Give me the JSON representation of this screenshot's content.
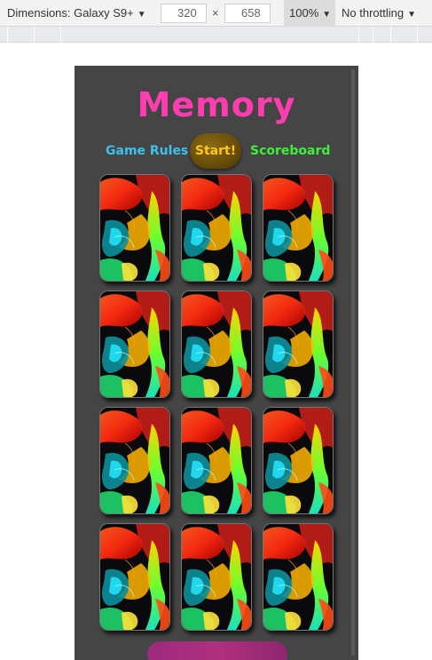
{
  "devtools": {
    "device_label": "Dimensions: Galaxy S9+",
    "width_value": "320",
    "height_value": "658",
    "times_sign": "×",
    "zoom": "100%",
    "throttling": "No throttling"
  },
  "app": {
    "title": "Memory",
    "nav": {
      "rules_label": "Game Rules",
      "start_label": "Start!",
      "scoreboard_label": "Scoreboard"
    },
    "colors": {
      "title": "#ff3db0",
      "rules": "#3cc2ec",
      "start_text": "#ffc61a",
      "scoreboard": "#3ff03a",
      "background": "#454545"
    },
    "cards": [
      {
        "state": "face-down"
      },
      {
        "state": "face-down"
      },
      {
        "state": "face-down"
      },
      {
        "state": "face-down"
      },
      {
        "state": "face-down"
      },
      {
        "state": "face-down"
      },
      {
        "state": "face-down"
      },
      {
        "state": "face-down"
      },
      {
        "state": "face-down"
      },
      {
        "state": "face-down"
      },
      {
        "state": "face-down"
      },
      {
        "state": "face-down"
      }
    ]
  }
}
